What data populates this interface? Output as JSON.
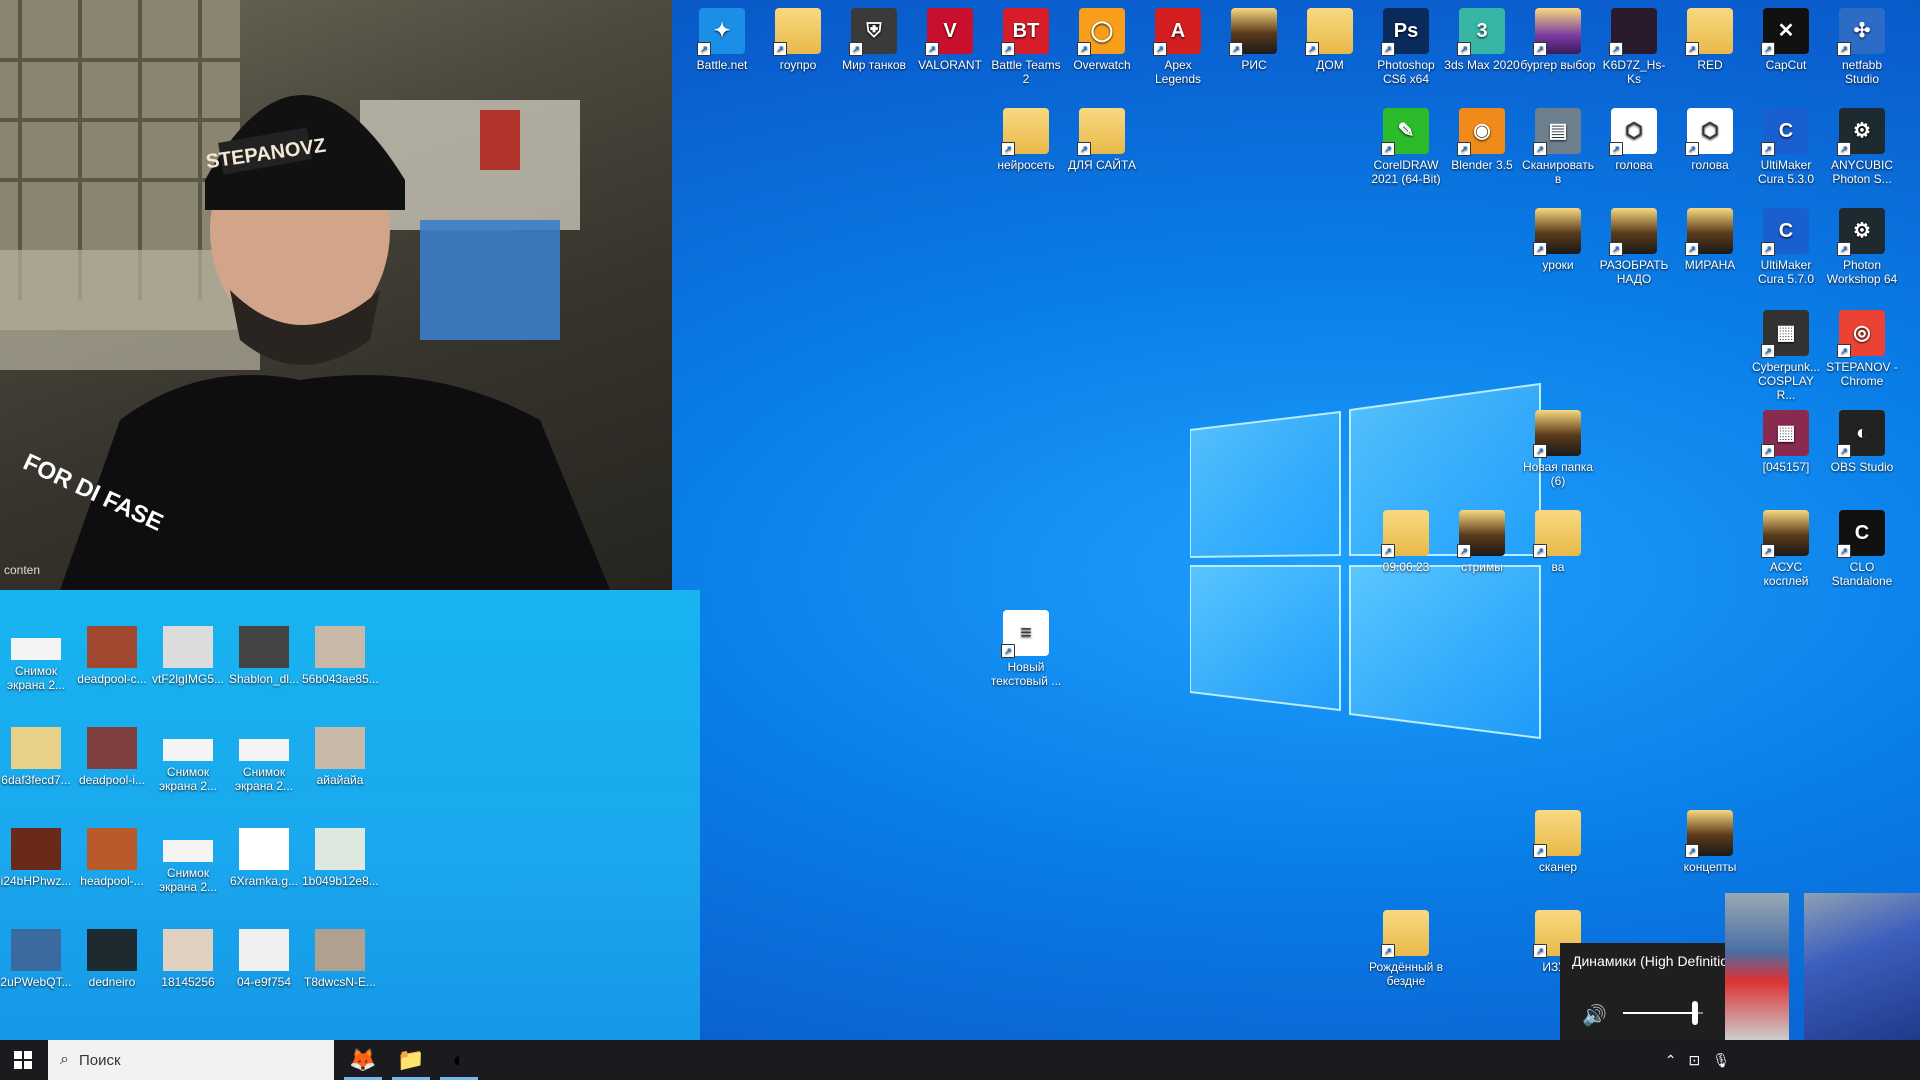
{
  "desktop_icons_top": [
    {
      "label": "Battle.net",
      "color": "#1b8fe8",
      "glyph": "✦"
    },
    {
      "label": "гоупро",
      "color": "folder",
      "glyph": ""
    },
    {
      "label": "Мир танков",
      "color": "#3a3a3a",
      "glyph": "⛨"
    },
    {
      "label": "VALORANT",
      "color": "#c8102e",
      "glyph": "V"
    },
    {
      "label": "Battle Teams 2",
      "color": "#d81d2a",
      "glyph": "BT"
    },
    {
      "label": "Overwatch",
      "color": "#f99e1a",
      "glyph": "◯"
    },
    {
      "label": "Apex Legends",
      "color": "#d41e20",
      "glyph": "A"
    },
    {
      "label": "РИС",
      "color": "folder-dark",
      "glyph": ""
    },
    {
      "label": "ДОМ",
      "color": "folder",
      "glyph": ""
    },
    {
      "label": "Photoshop CS6 x64",
      "color": "#0a2a5c",
      "glyph": "Ps"
    },
    {
      "label": "3ds Max 2020",
      "color": "#37b6a5",
      "glyph": "3"
    },
    {
      "label": "бургер выбор",
      "color": "folder-purple",
      "glyph": ""
    },
    {
      "label": "K6D7Z_Hs-Ks",
      "color": "#2a1a2e",
      "glyph": ""
    },
    {
      "label": "RED",
      "color": "folder",
      "glyph": ""
    },
    {
      "label": "CapCut",
      "color": "#111",
      "glyph": "✕"
    },
    {
      "label": "netfabb Studio",
      "color": "#2c6bc6",
      "glyph": "✣"
    }
  ],
  "desktop_icons_row2": [
    {
      "label": "нейросеть",
      "color": "folder",
      "glyph": ""
    },
    {
      "label": "ДЛЯ САЙТА",
      "color": "folder",
      "glyph": ""
    },
    {
      "label": "CorelDRAW 2021 (64-Bit)",
      "color": "#2bbb2b",
      "glyph": "✎"
    },
    {
      "label": "Blender 3.5",
      "color": "#f08a1a",
      "glyph": "◉"
    },
    {
      "label": "Сканировать в",
      "color": "#6e7f8e",
      "glyph": "▤"
    },
    {
      "label": "голова",
      "color": "#ffffff",
      "glyph": "⬡"
    },
    {
      "label": "голова",
      "color": "#ffffff",
      "glyph": "⬡"
    },
    {
      "label": "UltiMaker Cura 5.3.0",
      "color": "#1a5fd0",
      "glyph": "C"
    },
    {
      "label": "ANYCUBIC Photon S...",
      "color": "#1d2a2f",
      "glyph": "⚙"
    }
  ],
  "desktop_icons_row3": [
    {
      "label": "уроки",
      "color": "folder-dark",
      "glyph": ""
    },
    {
      "label": "РАЗОБРАТЬ НАДО",
      "color": "folder-dark",
      "glyph": ""
    },
    {
      "label": "МИРАНА",
      "color": "folder-dark",
      "glyph": ""
    },
    {
      "label": "UltiMaker Cura 5.7.0",
      "color": "#1a5fd0",
      "glyph": "C"
    },
    {
      "label": "Photon Workshop 64",
      "color": "#1d2a2f",
      "glyph": "⚙"
    }
  ],
  "desktop_icons_right": [
    {
      "label": "Cyberpunk... COSPLAY R...",
      "color": "#333",
      "glyph": "▦"
    },
    {
      "label": "STEPANOV - Chrome",
      "color": "#ea4335",
      "glyph": "◎"
    },
    {
      "label": "[045157]",
      "color": "#8a2a50",
      "glyph": "▦"
    },
    {
      "label": "OBS Studio",
      "color": "#222",
      "glyph": "◐"
    },
    {
      "label": "АСУС косплей",
      "color": "folder-dark",
      "glyph": ""
    },
    {
      "label": "CLO Standalone",
      "color": "#111",
      "glyph": "C"
    }
  ],
  "desktop_icons_middle": [
    {
      "label": "Новая папка (6)",
      "color": "folder-dark",
      "glyph": ""
    },
    {
      "label": "09.06.23",
      "color": "folder",
      "glyph": ""
    },
    {
      "label": "стримы",
      "color": "folder-dark",
      "glyph": ""
    },
    {
      "label": "ва",
      "color": "folder",
      "glyph": ""
    },
    {
      "label": "Новый текстовый ...",
      "color": "#ffffff",
      "glyph": "≡"
    },
    {
      "label": "сканер",
      "color": "folder",
      "glyph": ""
    },
    {
      "label": "концепты",
      "color": "folder-dark",
      "glyph": ""
    },
    {
      "label": "Рождённый в бездне",
      "color": "folder",
      "glyph": ""
    },
    {
      "label": "ИЗУЧ",
      "color": "folder",
      "glyph": ""
    }
  ],
  "desktop_icons_left": [
    {
      "label": "Снимок экрана 2...",
      "color": "#f4f4f4"
    },
    {
      "label": "deadpool-c...",
      "color": "#a04830"
    },
    {
      "label": "vtF2lgIMG5...",
      "color": "#dcdcdc"
    },
    {
      "label": "Shablon_dl...",
      "color": "#444"
    },
    {
      "label": "56b043ae85...",
      "color": "#c8b8a8"
    },
    {
      "label": "6daf3fecd7...",
      "color": "#e8d088"
    },
    {
      "label": "deadpool-i...",
      "color": "#804040"
    },
    {
      "label": "Снимок экрана 2...",
      "color": "#f4f4f4"
    },
    {
      "label": "Снимок экрана 2...",
      "color": "#f4f4f4"
    },
    {
      "label": "айайайа",
      "color": "#c8b8a8"
    },
    {
      "label": "i24bHPhwz...",
      "color": "#6a2a1a"
    },
    {
      "label": "headpool-...",
      "color": "#b85a2a"
    },
    {
      "label": "Снимок экрана 2...",
      "color": "#f4f4f4"
    },
    {
      "label": "6Xramka.g...",
      "color": "#ffffff"
    },
    {
      "label": "1b049b12e8...",
      "color": "#dce8e0"
    },
    {
      "label": "2uPWebQT...",
      "color": "#3a6aa0"
    },
    {
      "label": "dedneiro",
      "color": "#1d2a2f"
    },
    {
      "label": "18145256",
      "color": "#e0d0c0"
    },
    {
      "label": "04-e9f754",
      "color": "#f0f0f0"
    },
    {
      "label": "T8dwcsN-E...",
      "color": "#b0a090"
    }
  ],
  "webcam": {
    "hat_text": "STEPANOVZ",
    "shirt_text": "FOR DI FASE",
    "corner_text": "conten"
  },
  "taskbar": {
    "search_placeholder": "Поиск",
    "apps": [
      {
        "name": "firefox-icon",
        "glyph": "🦊"
      },
      {
        "name": "file-explorer-icon",
        "glyph": "📁"
      },
      {
        "name": "obs-icon",
        "glyph": "◐"
      }
    ]
  },
  "volume_popup": {
    "title": "Динамики (High Definition Audio)",
    "level": 0.9
  }
}
